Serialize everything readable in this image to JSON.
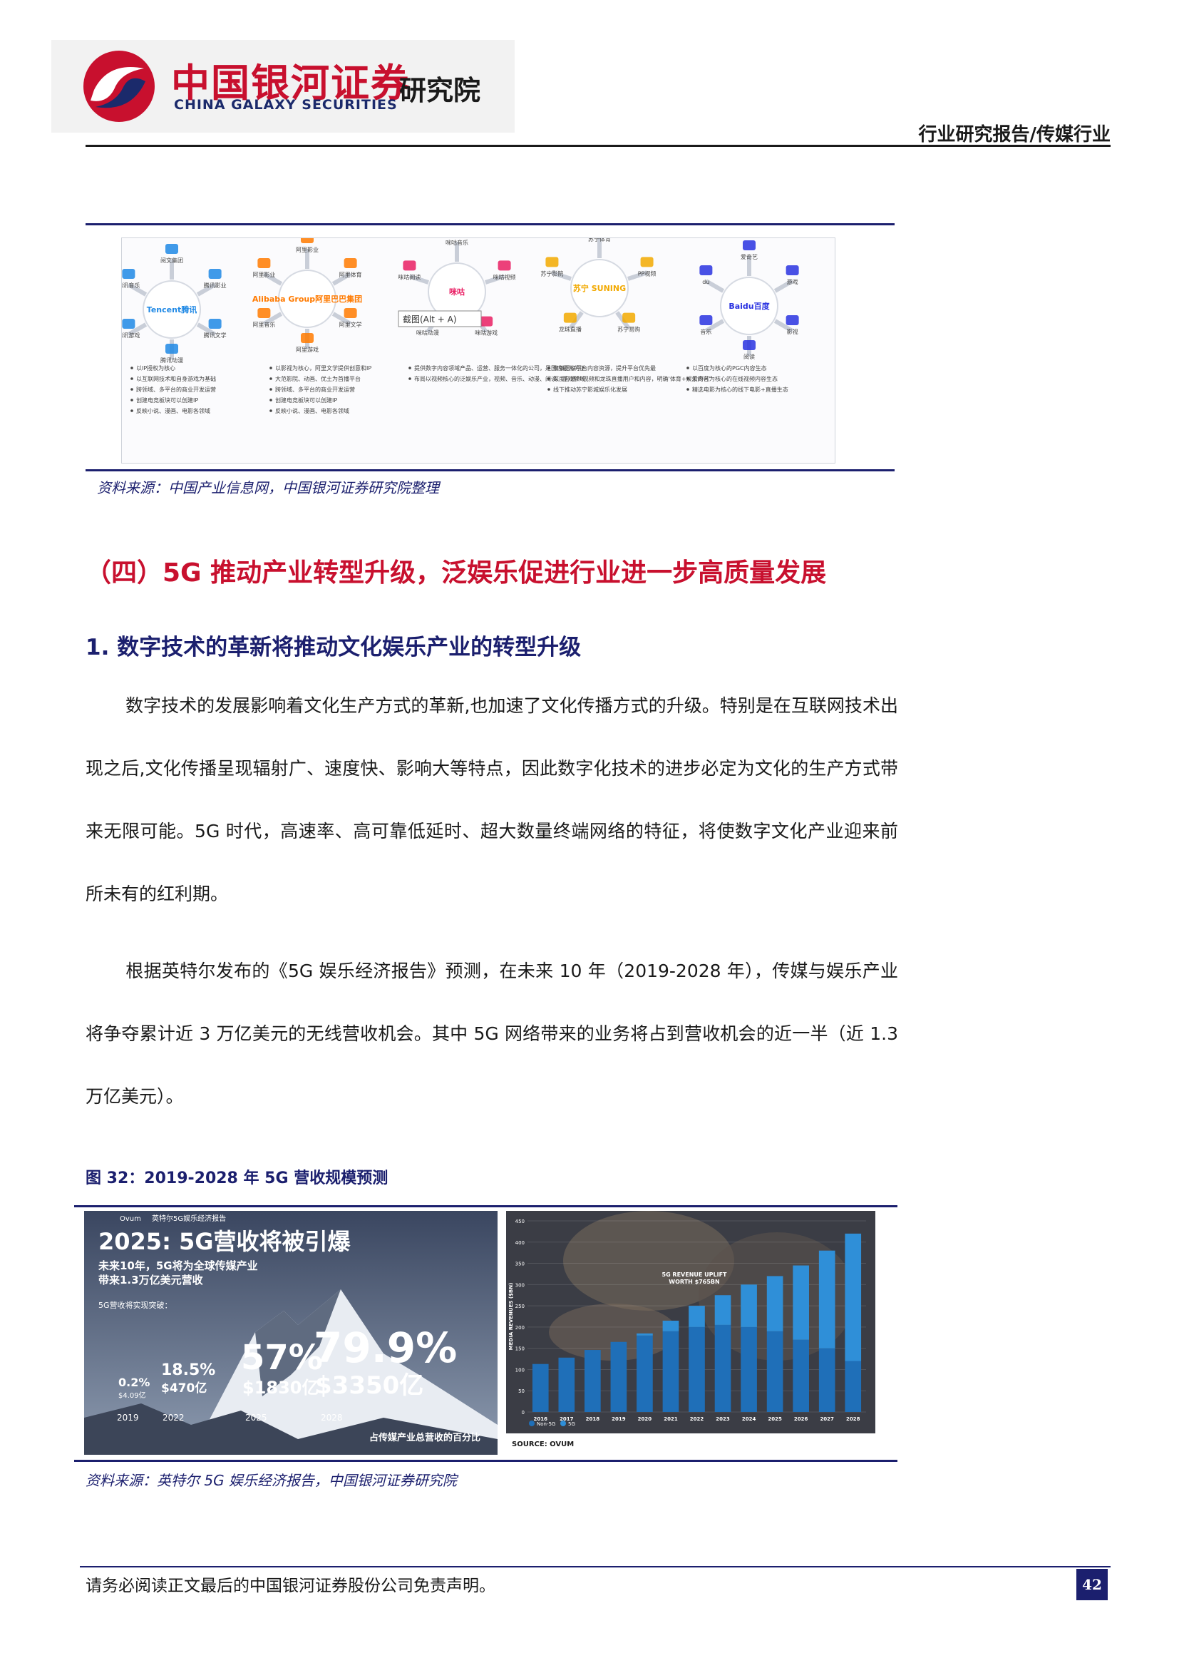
{
  "header": {
    "logo_cn": "中国银河证券",
    "logo_en": "CHINA GALAXY SECURITIES",
    "logo_inst": "研究院",
    "report_tag": "行业研究报告/传媒行业"
  },
  "figure1": {
    "source": "资料来源：中国产业信息网，中国银河证券研究院整理",
    "hubs": [
      {
        "name": "Tencent腾讯",
        "color": "#1e88e5",
        "spokes": [
          "阅文集团",
          "腾讯影业",
          "腾讯文学",
          "腾讯动漫",
          "腾讯游戏",
          "腾讯音乐"
        ],
        "bullets": [
          "以IP授权为核心",
          "以互联网技术和自身游戏为基础",
          "跨领域、多平台的商业开发运营",
          "创建电竞板块可以创建IP",
          "反映小说、漫画、电影各领域"
        ]
      },
      {
        "name": "Alibaba Group阿里巴巴集团",
        "color": "#ff7a00",
        "spokes": [
          "阿里影业",
          "阿里体育",
          "阿里文学",
          "阿里游戏",
          "阿里音乐",
          "阿里影业"
        ],
        "bullets": [
          "以影视为核心，阿里文学提供创意和IP",
          "大范影院、动画、优土为首播平台",
          "跨领域、多平台的商业开发运营",
          "创建电竞板块可以创建IP",
          "反映小说、漫画、电影各领域"
        ]
      },
      {
        "name": "咪咕",
        "color": "#e91e63",
        "spokes": [
          "咪咕音乐",
          "咪咕视频",
          "咪咕游戏",
          "咪咕动漫",
          "咪咕阅读"
        ],
        "bullets": [
          "提供数字内容领域产品、运营、服务一体化的公司，是国内最大的正版数字内容平台之一",
          "布局以视频核心的泛娱乐产业，视频、音乐、动漫、阅读、游戏领域均衡发展"
        ]
      },
      {
        "name": "苏宁 SUNING",
        "color": "#f2a900",
        "spokes": [
          "苏宁体育",
          "PP视频",
          "苏宁易购",
          "龙珠直播",
          "苏宁影院"
        ],
        "bullets": [
          "聚集国家平台内容资源，提升平台优先最",
          "深度打通PP视频和龙珠直播用户和内容，明确'体育+娱乐内容'运营策略",
          "线下推动苏宁影城娱乐化发展"
        ]
      },
      {
        "name": "Baidu百度",
        "color": "#2932e1",
        "spokes": [
          "爱奇艺",
          "游戏",
          "影视",
          "阅读",
          "音乐",
          "du"
        ],
        "bullets": [
          "以百度为核心的PGC内容生态",
          "爱奇艺为核心的在线视频内容生态",
          "精选电影为核心的线下电影+直播生态"
        ]
      }
    ],
    "tooltip": "截图(Alt + A)"
  },
  "section": {
    "title": "（四）5G 推动产业转型升级，泛娱乐促进行业进一步高质量发展",
    "subtitle": "1.  数字技术的革新将推动文化娱乐产业的转型升级",
    "p1": "数字技术的发展影响着文化生产方式的革新,也加速了文化传播方式的升级。特别是在互联网技术出现之后,文化传播呈现辐射广、速度快、影响大等特点，因此数字化技术的进步必定为文化的生产方式带来无限可能。5G 时代，高速率、高可靠低延时、超大数量终端网络的特征，将使数字文化产业迎来前所未有的红利期。",
    "p2": "根据英特尔发布的《5G 娱乐经济报告》预测，在未来 10 年（2019-2028 年），传媒与娱乐产业将争夺累计近 3 万亿美元的无线营收机会。其中 5G 网络带来的业务将占到营收机会的近一半（近 1.3 万亿美元）。"
  },
  "figure2": {
    "title": "图 32：2019-2028 年 5G 营收规模预测",
    "source": "资料来源：英特尔 5G 娱乐经济报告，中国银河证券研究院",
    "left_panel": {
      "brand": "Ovum",
      "caption": "英特尔5G娱乐经济报告",
      "headline": "2025: 5G营收将被引爆",
      "sub1": "未来10年，5G将为全球传媒产业",
      "sub2": "带来1.3万亿美元营收",
      "sub3": "5G营收将实现突破：",
      "bottom": "占传媒产业总营收的百分比",
      "points": [
        {
          "year": "2019",
          "pct": "0.2%",
          "amt": "$4.09亿"
        },
        {
          "year": "2022",
          "pct": "18.5%",
          "amt": "$470亿"
        },
        {
          "year": "2025",
          "pct": "57%",
          "amt": "$1830亿"
        },
        {
          "year": "2028",
          "pct": "79.9%",
          "amt": "$3350亿"
        }
      ]
    }
  },
  "chart_data": {
    "type": "bar",
    "title": "5G REVENUE UPLIFT WORTH $765BN",
    "ylabel": "MEDIA REVENUES ($BN)",
    "source_label": "SOURCE: OVUM",
    "ylim": [
      0,
      450
    ],
    "yticks": [
      0,
      50,
      100,
      150,
      200,
      250,
      300,
      350,
      400,
      450
    ],
    "categories": [
      "2016",
      "2017",
      "2018",
      "2019",
      "2020",
      "2021",
      "2022",
      "2023",
      "2024",
      "2025",
      "2026",
      "2027",
      "2028"
    ],
    "series": [
      {
        "name": "Non-5G",
        "color": "#1f6fb8",
        "values": [
          113,
          128,
          146,
          165,
          180,
          190,
          200,
          205,
          200,
          190,
          170,
          150,
          120
        ]
      },
      {
        "name": "5G",
        "color": "#2f8fd8",
        "values": [
          0,
          0,
          0,
          0,
          5,
          25,
          50,
          70,
          100,
          130,
          175,
          230,
          300
        ]
      }
    ],
    "legend": [
      "Non-5G",
      "5G"
    ]
  },
  "footer": {
    "note": "请务必阅读正文最后的中国银河证券股份公司免责声明。",
    "page": "42"
  }
}
